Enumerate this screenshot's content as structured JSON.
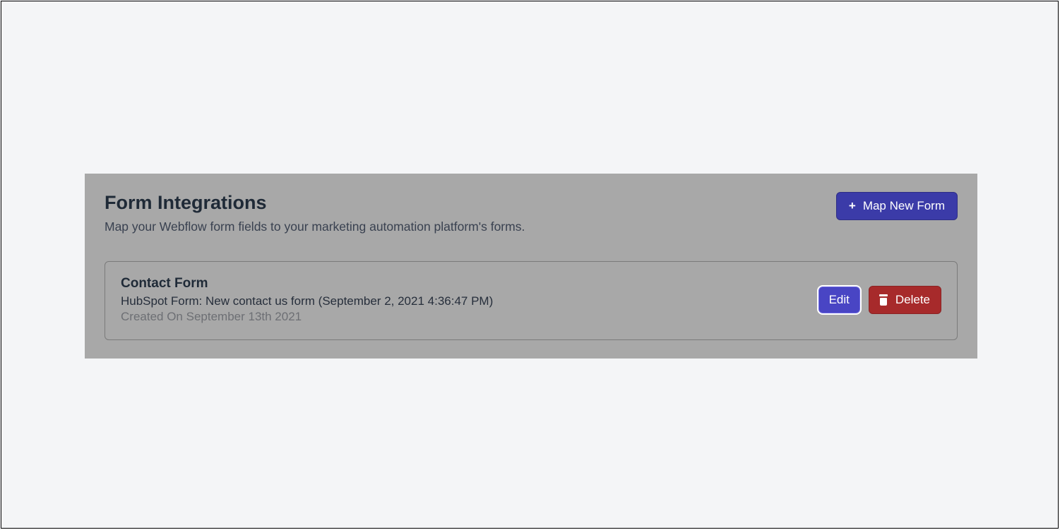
{
  "header": {
    "title": "Form Integrations",
    "subtitle": "Map your Webflow form fields to your marketing automation platform's forms.",
    "mapNewFormLabel": "Map New Form"
  },
  "formCard": {
    "title": "Contact Form",
    "detail": "HubSpot Form: New contact us form (September 2, 2021 4:36:47 PM)",
    "createdOn": "Created On September 13th 2021",
    "editLabel": "Edit",
    "deleteLabel": "Delete"
  }
}
